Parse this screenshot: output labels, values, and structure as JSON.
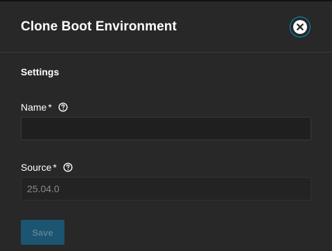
{
  "dialog": {
    "title": "Clone Boot Environment",
    "section_title": "Settings",
    "close_icon": "close-icon",
    "accent_color": "#0095d5"
  },
  "fields": {
    "name": {
      "label": "Name",
      "required_marker": "*",
      "value": "",
      "help_icon": "help-icon"
    },
    "source": {
      "label": "Source",
      "required_marker": "*",
      "value": "25.04.0",
      "disabled": true,
      "help_icon": "help-icon"
    }
  },
  "actions": {
    "save_label": "Save",
    "save_disabled": true
  }
}
